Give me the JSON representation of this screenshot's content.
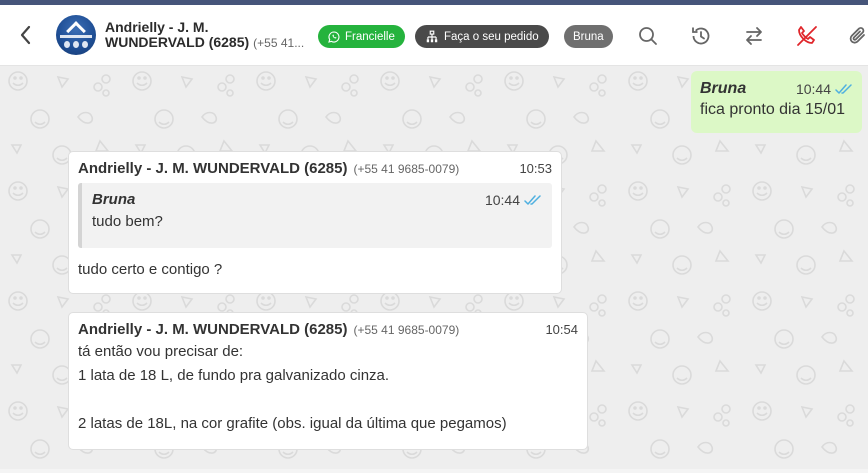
{
  "header": {
    "contact_name_line1": "Andrielly - J. M.",
    "contact_name_line2": "WUNDERVALD (6285)",
    "contact_phone_truncated": "(+55 41...",
    "chips": {
      "agent": "Francielle",
      "order": "Faça o seu pedido",
      "user": "Bruna"
    },
    "icons": [
      "back-arrow-icon",
      "whatsapp-icon",
      "sitemap-icon",
      "search-icon",
      "history-icon",
      "transfer-icon",
      "end-call-icon",
      "attach-icon"
    ],
    "colors": {
      "whatsapp_chip": "#25b33d",
      "order_chip": "#4a4a4a",
      "user_chip": "#6f6f6f",
      "end_call": "#e0262b"
    }
  },
  "messages": {
    "outgoing": {
      "sender": "Bruna",
      "time": "10:44",
      "text": "fica pronto dia 15/01"
    },
    "incoming1": {
      "sender": "Andrielly - J. M. WUNDERVALD (6285)",
      "phone": "(+55 41 9685-0079)",
      "time": "10:53",
      "quoted": {
        "sender": "Bruna",
        "time": "10:44",
        "text": "tudo bem?"
      },
      "text": "tudo certo e contigo ?"
    },
    "incoming2": {
      "sender": "Andrielly - J. M. WUNDERVALD (6285)",
      "phone": "(+55 41 9685-0079)",
      "time": "10:54",
      "lines": [
        "tá então vou precisar de:",
        "1 lata de 18 L, de fundo pra galvanizado cinza.",
        "2 latas de 18L, na cor grafite (obs. igual da última que pegamos)"
      ]
    }
  },
  "colors": {
    "outgoing_bubble": "#dcf8c6",
    "read_ticks": "#4fb0e0"
  }
}
